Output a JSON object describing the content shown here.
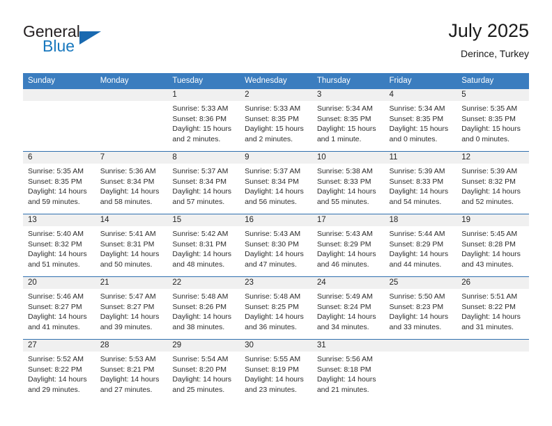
{
  "brand": {
    "name_part1": "General",
    "name_part2": "Blue",
    "logo_icon": "triangle-flag-icon",
    "color_primary": "#1878be",
    "color_dark": "#231f20"
  },
  "header": {
    "title": "July 2025",
    "subtitle": "Derince, Turkey"
  },
  "theme": {
    "header_bg": "#3b7dbf",
    "row_divider": "#2f6fae",
    "daynum_bg": "#f0f0f0",
    "text": "#2b2b2b"
  },
  "weekday_headers": [
    "Sunday",
    "Monday",
    "Tuesday",
    "Wednesday",
    "Thursday",
    "Friday",
    "Saturday"
  ],
  "labels": {
    "sunrise": "Sunrise:",
    "sunset": "Sunset:",
    "daylight": "Daylight:"
  },
  "weeks": [
    [
      {
        "day": "",
        "sunrise": "",
        "sunset": "",
        "daylight": "",
        "empty": true
      },
      {
        "day": "",
        "sunrise": "",
        "sunset": "",
        "daylight": "",
        "empty": true
      },
      {
        "day": "1",
        "sunrise": "Sunrise: 5:33 AM",
        "sunset": "Sunset: 8:36 PM",
        "daylight": "Daylight: 15 hours and 2 minutes."
      },
      {
        "day": "2",
        "sunrise": "Sunrise: 5:33 AM",
        "sunset": "Sunset: 8:35 PM",
        "daylight": "Daylight: 15 hours and 2 minutes."
      },
      {
        "day": "3",
        "sunrise": "Sunrise: 5:34 AM",
        "sunset": "Sunset: 8:35 PM",
        "daylight": "Daylight: 15 hours and 1 minute."
      },
      {
        "day": "4",
        "sunrise": "Sunrise: 5:34 AM",
        "sunset": "Sunset: 8:35 PM",
        "daylight": "Daylight: 15 hours and 0 minutes."
      },
      {
        "day": "5",
        "sunrise": "Sunrise: 5:35 AM",
        "sunset": "Sunset: 8:35 PM",
        "daylight": "Daylight: 15 hours and 0 minutes."
      }
    ],
    [
      {
        "day": "6",
        "sunrise": "Sunrise: 5:35 AM",
        "sunset": "Sunset: 8:35 PM",
        "daylight": "Daylight: 14 hours and 59 minutes."
      },
      {
        "day": "7",
        "sunrise": "Sunrise: 5:36 AM",
        "sunset": "Sunset: 8:34 PM",
        "daylight": "Daylight: 14 hours and 58 minutes."
      },
      {
        "day": "8",
        "sunrise": "Sunrise: 5:37 AM",
        "sunset": "Sunset: 8:34 PM",
        "daylight": "Daylight: 14 hours and 57 minutes."
      },
      {
        "day": "9",
        "sunrise": "Sunrise: 5:37 AM",
        "sunset": "Sunset: 8:34 PM",
        "daylight": "Daylight: 14 hours and 56 minutes."
      },
      {
        "day": "10",
        "sunrise": "Sunrise: 5:38 AM",
        "sunset": "Sunset: 8:33 PM",
        "daylight": "Daylight: 14 hours and 55 minutes."
      },
      {
        "day": "11",
        "sunrise": "Sunrise: 5:39 AM",
        "sunset": "Sunset: 8:33 PM",
        "daylight": "Daylight: 14 hours and 54 minutes."
      },
      {
        "day": "12",
        "sunrise": "Sunrise: 5:39 AM",
        "sunset": "Sunset: 8:32 PM",
        "daylight": "Daylight: 14 hours and 52 minutes."
      }
    ],
    [
      {
        "day": "13",
        "sunrise": "Sunrise: 5:40 AM",
        "sunset": "Sunset: 8:32 PM",
        "daylight": "Daylight: 14 hours and 51 minutes."
      },
      {
        "day": "14",
        "sunrise": "Sunrise: 5:41 AM",
        "sunset": "Sunset: 8:31 PM",
        "daylight": "Daylight: 14 hours and 50 minutes."
      },
      {
        "day": "15",
        "sunrise": "Sunrise: 5:42 AM",
        "sunset": "Sunset: 8:31 PM",
        "daylight": "Daylight: 14 hours and 48 minutes."
      },
      {
        "day": "16",
        "sunrise": "Sunrise: 5:43 AM",
        "sunset": "Sunset: 8:30 PM",
        "daylight": "Daylight: 14 hours and 47 minutes."
      },
      {
        "day": "17",
        "sunrise": "Sunrise: 5:43 AM",
        "sunset": "Sunset: 8:29 PM",
        "daylight": "Daylight: 14 hours and 46 minutes."
      },
      {
        "day": "18",
        "sunrise": "Sunrise: 5:44 AM",
        "sunset": "Sunset: 8:29 PM",
        "daylight": "Daylight: 14 hours and 44 minutes."
      },
      {
        "day": "19",
        "sunrise": "Sunrise: 5:45 AM",
        "sunset": "Sunset: 8:28 PM",
        "daylight": "Daylight: 14 hours and 43 minutes."
      }
    ],
    [
      {
        "day": "20",
        "sunrise": "Sunrise: 5:46 AM",
        "sunset": "Sunset: 8:27 PM",
        "daylight": "Daylight: 14 hours and 41 minutes."
      },
      {
        "day": "21",
        "sunrise": "Sunrise: 5:47 AM",
        "sunset": "Sunset: 8:27 PM",
        "daylight": "Daylight: 14 hours and 39 minutes."
      },
      {
        "day": "22",
        "sunrise": "Sunrise: 5:48 AM",
        "sunset": "Sunset: 8:26 PM",
        "daylight": "Daylight: 14 hours and 38 minutes."
      },
      {
        "day": "23",
        "sunrise": "Sunrise: 5:48 AM",
        "sunset": "Sunset: 8:25 PM",
        "daylight": "Daylight: 14 hours and 36 minutes."
      },
      {
        "day": "24",
        "sunrise": "Sunrise: 5:49 AM",
        "sunset": "Sunset: 8:24 PM",
        "daylight": "Daylight: 14 hours and 34 minutes."
      },
      {
        "day": "25",
        "sunrise": "Sunrise: 5:50 AM",
        "sunset": "Sunset: 8:23 PM",
        "daylight": "Daylight: 14 hours and 33 minutes."
      },
      {
        "day": "26",
        "sunrise": "Sunrise: 5:51 AM",
        "sunset": "Sunset: 8:22 PM",
        "daylight": "Daylight: 14 hours and 31 minutes."
      }
    ],
    [
      {
        "day": "27",
        "sunrise": "Sunrise: 5:52 AM",
        "sunset": "Sunset: 8:22 PM",
        "daylight": "Daylight: 14 hours and 29 minutes."
      },
      {
        "day": "28",
        "sunrise": "Sunrise: 5:53 AM",
        "sunset": "Sunset: 8:21 PM",
        "daylight": "Daylight: 14 hours and 27 minutes."
      },
      {
        "day": "29",
        "sunrise": "Sunrise: 5:54 AM",
        "sunset": "Sunset: 8:20 PM",
        "daylight": "Daylight: 14 hours and 25 minutes."
      },
      {
        "day": "30",
        "sunrise": "Sunrise: 5:55 AM",
        "sunset": "Sunset: 8:19 PM",
        "daylight": "Daylight: 14 hours and 23 minutes."
      },
      {
        "day": "31",
        "sunrise": "Sunrise: 5:56 AM",
        "sunset": "Sunset: 8:18 PM",
        "daylight": "Daylight: 14 hours and 21 minutes."
      },
      {
        "day": "",
        "sunrise": "",
        "sunset": "",
        "daylight": "",
        "empty": true
      },
      {
        "day": "",
        "sunrise": "",
        "sunset": "",
        "daylight": "",
        "empty": true
      }
    ]
  ]
}
